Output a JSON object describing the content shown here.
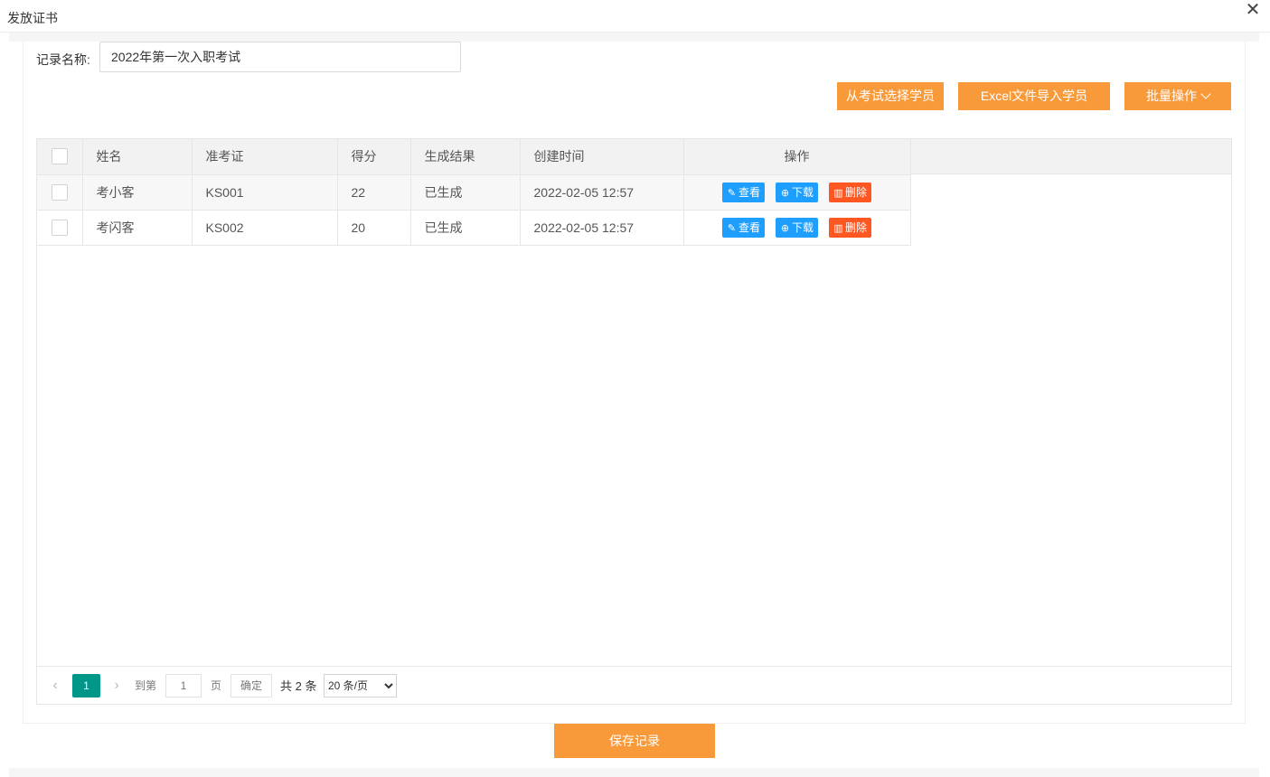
{
  "dialog": {
    "title": "发放证书",
    "close_icon": "close-icon"
  },
  "form": {
    "name_label": "记录名称:",
    "name_value": "2022年第一次入职考试"
  },
  "toolbar": {
    "select_from_exam": "从考试选择学员",
    "import_excel": "Excel文件导入学员",
    "batch_ops": "批量操作",
    "batch_ops_icon": "chevron-down-icon"
  },
  "table": {
    "columns": [
      "姓名",
      "准考证",
      "得分",
      "生成结果",
      "创建时间",
      "操作"
    ],
    "rows": [
      {
        "name": "考小客",
        "ticket": "KS001",
        "score": "22",
        "result": "已生成",
        "created": "2022-02-05 12:57"
      },
      {
        "name": "考闪客",
        "ticket": "KS002",
        "score": "20",
        "result": "已生成",
        "created": "2022-02-05 12:57"
      }
    ],
    "actions": {
      "view": "查看",
      "download": "下载",
      "delete": "删除"
    }
  },
  "pager": {
    "current_page": "1",
    "goto_label": "到第",
    "page_input_value": "1",
    "page_unit": "页",
    "confirm": "确定",
    "total": "共 2 条",
    "page_size": "20 条/页"
  },
  "footer": {
    "save": "保存记录"
  },
  "colors": {
    "accent_orange": "#f99a3a",
    "view_blue": "#1e9fff",
    "delete_red": "#ff5722",
    "pager_teal": "#009688"
  }
}
